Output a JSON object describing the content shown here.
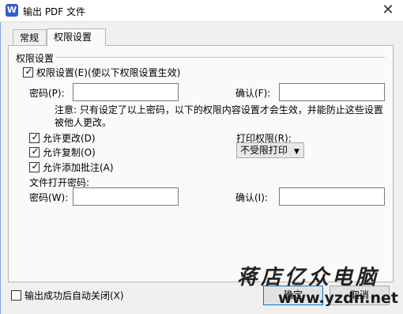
{
  "window": {
    "title": "输出 PDF 文件",
    "app_icon_letter": "W"
  },
  "tabs": [
    {
      "label": "常规"
    },
    {
      "label": "权限设置"
    }
  ],
  "permissions": {
    "section_title": "权限设置",
    "enable_label": "权限设置(E)(使以下权限设置生效)",
    "enable_checked": true,
    "password_label": "密码(P):",
    "password_value": "",
    "confirm_label": "确认(F):",
    "confirm_value": "",
    "note": "注意: 只有设定了以上密码，以下的权限内容设置才会生效，并能防止这些设置被他人更改。",
    "allow_modify_label": "允许更改(D)",
    "allow_modify_checked": true,
    "allow_copy_label": "允许复制(O)",
    "allow_copy_checked": true,
    "allow_annotate_label": "允许添加批注(A)",
    "allow_annotate_checked": true,
    "print_label": "打印权限(R):",
    "print_value": "不受限打印",
    "open_password_title": "文件打开密码:",
    "open_password_label": "密码(W):",
    "open_password_value": "",
    "open_confirm_label": "确认(I):",
    "open_confirm_value": ""
  },
  "footer": {
    "auto_close_label": "输出成功后自动关闭(X)",
    "auto_close_checked": false,
    "ok_label": "确定",
    "cancel_label": "取消"
  },
  "watermark": {
    "cn": "蒋店亿众电脑",
    "url": "www.yzdn.net"
  }
}
